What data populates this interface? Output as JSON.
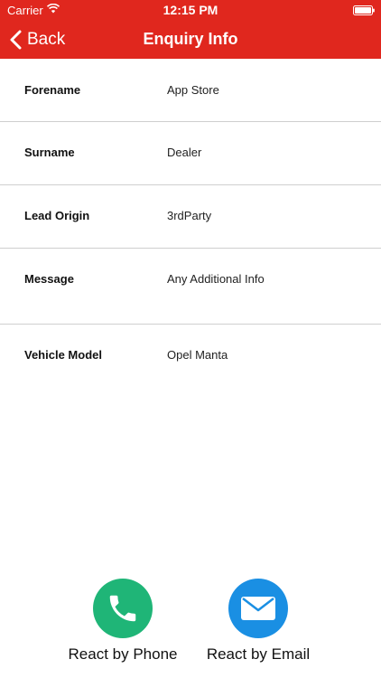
{
  "status_bar": {
    "carrier": "Carrier",
    "time": "12:15 PM"
  },
  "nav": {
    "back_label": "Back",
    "title": "Enquiry Info",
    "bar_color": "#e0271e"
  },
  "rows": [
    {
      "label": "Forename",
      "value": "App Store"
    },
    {
      "label": "Surname",
      "value": "Dealer"
    },
    {
      "label": "Lead Origin",
      "value": "3rdParty"
    },
    {
      "label": "Message",
      "value": "Any Additional Info"
    },
    {
      "label": "Vehicle Model",
      "value": "Opel Manta"
    }
  ],
  "actions": {
    "phone": {
      "label": "React by Phone",
      "color": "#1fb577",
      "icon": "phone-icon"
    },
    "email": {
      "label": "React by Email",
      "color": "#1a8fe3",
      "icon": "envelope-icon"
    }
  }
}
